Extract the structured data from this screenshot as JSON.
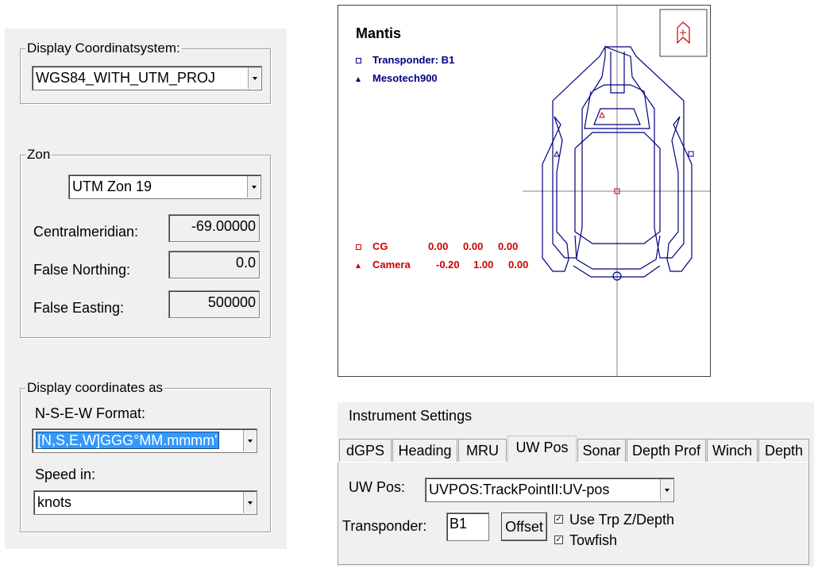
{
  "display_coordsys": {
    "group_title": "Display Coordinatsystem:",
    "value": "WGS84_WITH_UTM_PROJ"
  },
  "zone": {
    "group_title": "Zon",
    "value": "UTM Zon 19",
    "central_meridian_label": "Centralmeridian:",
    "central_meridian_value": "-69.00000",
    "false_northing_label": "False Northing:",
    "false_northing_value": "0.0",
    "false_easting_label": "False Easting:",
    "false_easting_value": "500000"
  },
  "display_as": {
    "group_title": "Display coordinates as",
    "format_label": "N-S-E-W Format:",
    "format_value": "[N,S,E,W]GGG°MM.mmmm'",
    "speed_label": "Speed in:",
    "speed_value": "knots"
  },
  "vessel": {
    "title": "Mantis",
    "legend": [
      {
        "symbol": "square",
        "label": "Transponder: B1",
        "color": "#000080"
      },
      {
        "symbol": "triangle",
        "label": "Mesotech900",
        "color": "#000080"
      }
    ],
    "offsets": [
      {
        "symbol": "square",
        "name": "CG",
        "x": "0.00",
        "y": "0.00",
        "z": "0.00",
        "color": "#cc0000"
      },
      {
        "symbol": "triangle",
        "name": "Camera",
        "x": "-0.20",
        "y": "1.00",
        "z": "0.00",
        "color": "#cc0000"
      }
    ],
    "compass_icon": "north-arrow-icon"
  },
  "instrument": {
    "title": "Instrument Settings",
    "tabs": [
      "dGPS",
      "Heading",
      "MRU",
      "UW Pos",
      "Sonar",
      "Depth Prof",
      "Winch",
      "Depth"
    ],
    "active_tab": "UW Pos",
    "uwpos_label": "UW Pos:",
    "uwpos_value": "UVPOS:TrackPointII:UV-pos",
    "transponder_label": "Transponder:",
    "transponder_value": "B1",
    "offset_button": "Offset",
    "use_trp_label": "Use Trp Z/Depth",
    "use_trp_checked": true,
    "towfish_label": "Towfish",
    "towfish_checked": true
  }
}
